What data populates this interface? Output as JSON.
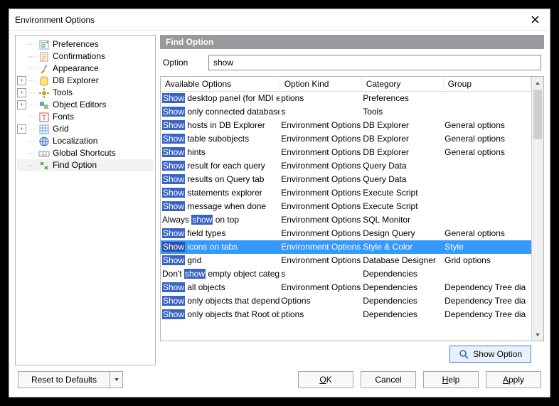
{
  "window": {
    "title": "Environment Options"
  },
  "tree": {
    "items": [
      {
        "label": "Preferences",
        "twisty": "",
        "level": 0,
        "icon": "checklist",
        "selected": false
      },
      {
        "label": "Confirmations",
        "twisty": "",
        "level": 0,
        "icon": "memo",
        "selected": false
      },
      {
        "label": "Appearance",
        "twisty": "",
        "level": 0,
        "icon": "tools",
        "selected": false
      },
      {
        "label": "DB Explorer",
        "twisty": "+",
        "level": 0,
        "icon": "db",
        "selected": false
      },
      {
        "label": "Tools",
        "twisty": "+",
        "level": 0,
        "icon": "gear",
        "selected": false
      },
      {
        "label": "Object Editors",
        "twisty": "+",
        "level": 0,
        "icon": "editors",
        "selected": false
      },
      {
        "label": "Fonts",
        "twisty": "",
        "level": 0,
        "icon": "font",
        "selected": false
      },
      {
        "label": "Grid",
        "twisty": "+",
        "level": 0,
        "icon": "grid",
        "selected": false
      },
      {
        "label": "Localization",
        "twisty": "",
        "level": 0,
        "icon": "globe",
        "selected": false
      },
      {
        "label": "Global Shortcuts",
        "twisty": "",
        "level": 0,
        "icon": "keyboard",
        "selected": false
      },
      {
        "label": "Find Option",
        "twisty": "",
        "level": 0,
        "icon": "find",
        "selected": true
      }
    ]
  },
  "pane": {
    "header": "Find Option",
    "option_label": "Option",
    "option_value": "show",
    "show_button": "Show Option"
  },
  "columns": {
    "c0": "Available Options",
    "c1": "Option Kind",
    "c2": "Category",
    "c3": "Group"
  },
  "rows": [
    {
      "pre": "",
      "m": "Show",
      "post": " desktop panel (for MDI environment only)",
      "kind": "ptions",
      "cat": "Preferences",
      "grp": "",
      "sel": false
    },
    {
      "pre": "",
      "m": "Show",
      "post": " only connected databases in drop-down menu",
      "kind": "s",
      "cat": "Tools",
      "grp": "",
      "sel": false
    },
    {
      "pre": "",
      "m": "Show",
      "post": " hosts in DB Explorer",
      "kind": "Environment Options",
      "cat": "DB Explorer",
      "grp": "General options",
      "sel": false
    },
    {
      "pre": "",
      "m": "Show",
      "post": " table subobjects",
      "kind": "Environment Options",
      "cat": "DB Explorer",
      "grp": "General options",
      "sel": false
    },
    {
      "pre": "",
      "m": "Show",
      "post": " hints",
      "kind": "Environment Options",
      "cat": "DB Explorer",
      "grp": "General options",
      "sel": false
    },
    {
      "pre": "",
      "m": "Show",
      "post": " result for each query",
      "kind": "Environment Options",
      "cat": "Query Data",
      "grp": "",
      "sel": false
    },
    {
      "pre": "",
      "m": "Show",
      "post": " results on Query tab",
      "kind": "Environment Options",
      "cat": "Query Data",
      "grp": "",
      "sel": false
    },
    {
      "pre": "",
      "m": "Show",
      "post": " statements explorer",
      "kind": "Environment Options",
      "cat": "Execute Script",
      "grp": "",
      "sel": false
    },
    {
      "pre": "",
      "m": "Show",
      "post": " message when done",
      "kind": "Environment Options",
      "cat": "Execute Script",
      "grp": "",
      "sel": false
    },
    {
      "pre": "Always ",
      "m": "show",
      "post": " on top",
      "kind": "Environment Options",
      "cat": "SQL Monitor",
      "grp": "",
      "sel": false
    },
    {
      "pre": "",
      "m": "Show",
      "post": " field types",
      "kind": "Environment Options",
      "cat": "Design Query",
      "grp": "General options",
      "sel": false
    },
    {
      "pre": "",
      "m": "Show",
      "post": " icons on tabs",
      "kind": "Environment Options",
      "cat": "Style & Color",
      "grp": "Style",
      "sel": true
    },
    {
      "pre": "",
      "m": "Show",
      "post": " grid",
      "kind": "Environment Options",
      "cat": "Database Designer",
      "grp": "Grid options",
      "sel": false
    },
    {
      "pre": "Don't ",
      "m": "show",
      "post": " empty object categories in dependencies",
      "kind": "s",
      "cat": "Dependencies",
      "grp": "",
      "sel": false
    },
    {
      "pre": "",
      "m": "Show",
      "post": " all objects",
      "kind": "Environment Options",
      "cat": "Dependencies",
      "grp": "Dependency Tree dia",
      "sel": false
    },
    {
      "pre": "",
      "m": "Show",
      "post": " only objects that depend on Root object",
      "kind": "Options",
      "cat": "Dependencies",
      "grp": "Dependency Tree dia",
      "sel": false
    },
    {
      "pre": "",
      "m": "Show",
      "post": " only objects that Root object depends on",
      "kind": "ptions",
      "cat": "Dependencies",
      "grp": "Dependency Tree dia",
      "sel": false
    }
  ],
  "footer": {
    "reset": "Reset to Defaults",
    "ok": "OK",
    "ok_ul": "O",
    "ok_rest": "K",
    "cancel": "Cancel",
    "help": "Help",
    "help_ul": "H",
    "help_rest": "elp",
    "apply": "Apply",
    "apply_ul": "A",
    "apply_rest": "pply"
  }
}
